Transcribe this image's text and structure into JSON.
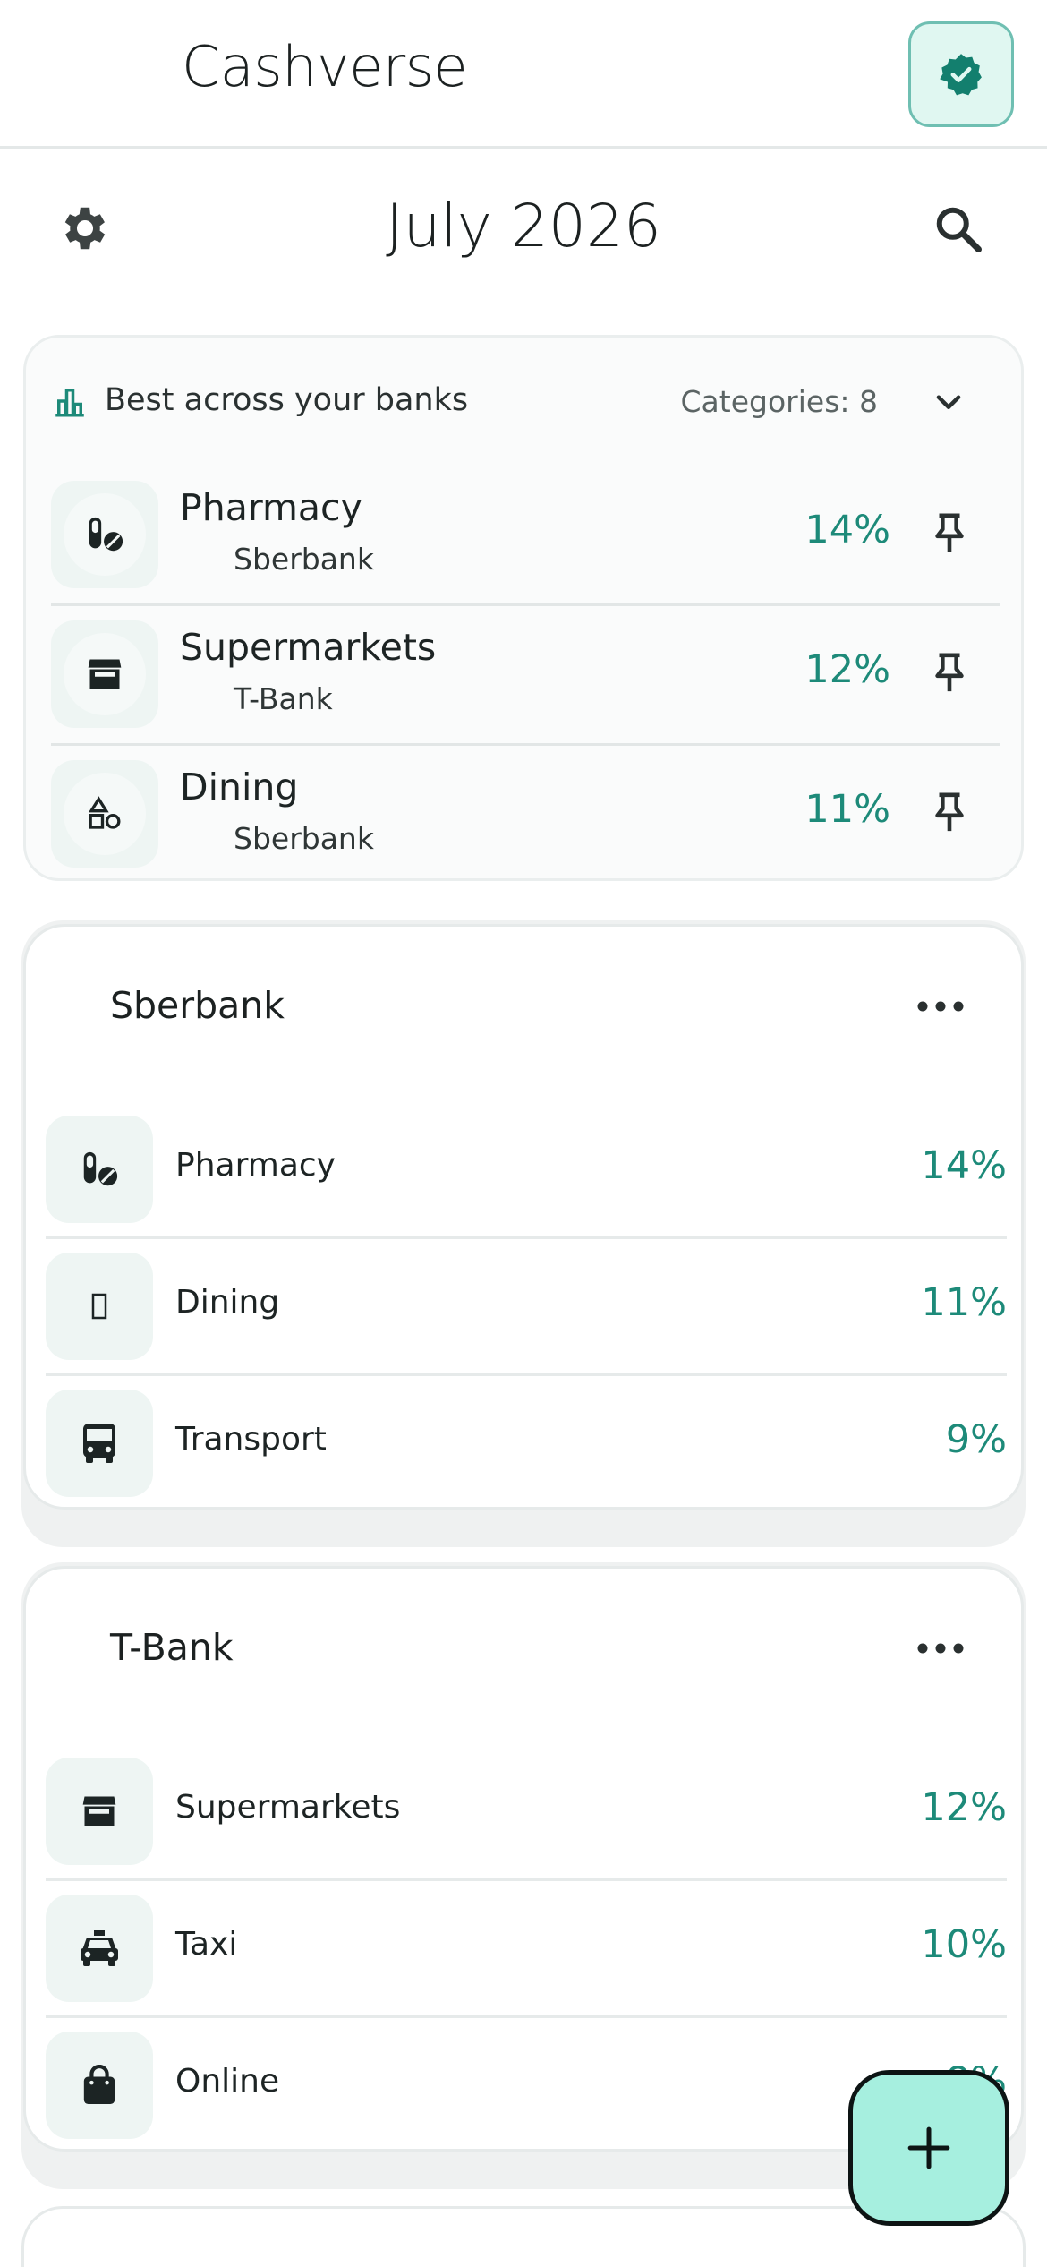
{
  "app": {
    "title": "Cashverse"
  },
  "header": {
    "month": "July 2026"
  },
  "best": {
    "title": "Best across your banks",
    "categories_count": "Categories: 8",
    "rows": [
      {
        "name": "Pharmacy",
        "bank": "Sberbank",
        "percent": "14%",
        "icon": "pills-icon"
      },
      {
        "name": "Supermarkets",
        "bank": "T-Bank",
        "percent": "12%",
        "icon": "store-icon"
      },
      {
        "name": "Dining",
        "bank": "Sberbank",
        "percent": "11%",
        "icon": "shapes-icon"
      }
    ]
  },
  "banks": [
    {
      "name": "Sberbank",
      "rows": [
        {
          "name": "Pharmacy",
          "percent": "14%",
          "icon": "pills-icon"
        },
        {
          "name": "Dining",
          "percent": "11%",
          "icon": "missing-glyph-icon"
        },
        {
          "name": "Transport",
          "percent": "9%",
          "icon": "bus-icon"
        }
      ]
    },
    {
      "name": "T-Bank",
      "rows": [
        {
          "name": "Supermarkets",
          "percent": "12%",
          "icon": "store-icon"
        },
        {
          "name": "Taxi",
          "percent": "10%",
          "icon": "taxi-icon"
        },
        {
          "name": "Online",
          "percent": "8%",
          "icon": "shopping-bag-icon"
        }
      ]
    }
  ],
  "fab": {
    "label": "+"
  },
  "colors": {
    "accent": "#1d8a79",
    "fab": "#a6efdf",
    "verify_bg": "#e0f7f1",
    "icon_tile": "#eef5f3"
  }
}
